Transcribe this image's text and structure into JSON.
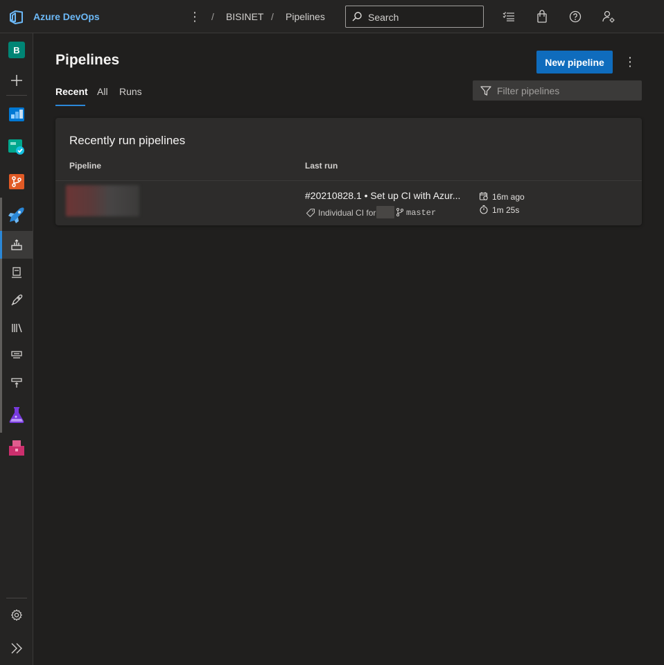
{
  "app": {
    "brand": "Azure DevOps",
    "accent": "#2b88d8",
    "brand_color": "#6cb8f6"
  },
  "breadcrumb": {
    "separator": "/",
    "items": [
      "BISINET",
      "Pipelines"
    ]
  },
  "search": {
    "placeholder": "Search",
    "icon": "search-icon"
  },
  "header_icons": [
    "task-list-icon",
    "shopping-bag-icon",
    "help-icon",
    "user-settings-icon"
  ],
  "leftnav": {
    "project_initial": "B",
    "project_color": "#008575",
    "items": [
      {
        "name": "add",
        "icon": "plus-icon"
      },
      {
        "name": "boards",
        "icon": "boards-icon"
      },
      {
        "name": "test-plans-overview",
        "icon": "check-board-icon"
      },
      {
        "name": "repos",
        "icon": "repos-icon"
      },
      {
        "name": "pipelines",
        "icon": "rocket-icon"
      },
      {
        "name": "pipelines-sub",
        "icon": "pipeline-icon",
        "selected": true
      },
      {
        "name": "environments",
        "icon": "server-icon"
      },
      {
        "name": "releases",
        "icon": "release-rocket-icon"
      },
      {
        "name": "library",
        "icon": "library-icon"
      },
      {
        "name": "task-groups",
        "icon": "task-group-icon"
      },
      {
        "name": "deployment-groups",
        "icon": "deployment-icon"
      },
      {
        "name": "test-plans",
        "icon": "flask-icon"
      },
      {
        "name": "artifacts",
        "icon": "package-icon"
      }
    ],
    "settings_icon": "gear-icon",
    "expand_icon": "double-chevron-right-icon"
  },
  "main": {
    "title": "Pipelines",
    "tabs": [
      {
        "label": "Recent",
        "active": true
      },
      {
        "label": "All",
        "active": false
      },
      {
        "label": "Runs",
        "active": false
      }
    ],
    "new_button": "New pipeline",
    "more_icon": "more-vertical-icon",
    "filter_placeholder": "Filter pipelines",
    "card": {
      "title": "Recently run pipelines",
      "columns": [
        "Pipeline",
        "Last run"
      ],
      "rows": [
        {
          "pipeline_name": "",
          "run_title": "#20210828.1 • Set up CI with Azur...",
          "reason": "Individual CI for",
          "branch": "master",
          "started": "16m ago",
          "duration": "1m 25s"
        }
      ]
    }
  }
}
